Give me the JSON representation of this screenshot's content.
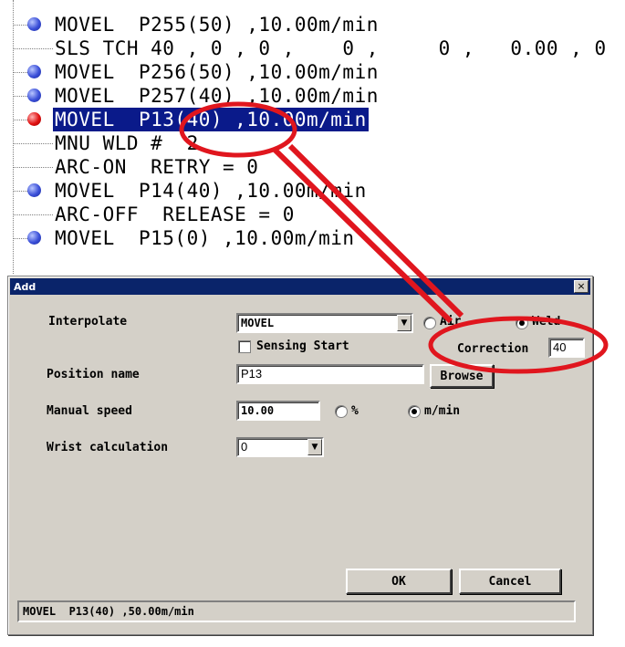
{
  "program": {
    "lines": [
      {
        "text": "MOVEL  P255(50) ,10.00m/min",
        "bullet": "blue"
      },
      {
        "text": "SLS TCH 40 , 0 , 0 ,    0 ,     0 ,   0.00 , 0",
        "bullet": "none"
      },
      {
        "text": "MOVEL  P256(50) ,10.00m/min",
        "bullet": "blue"
      },
      {
        "text": "MOVEL  P257(40) ,10.00m/min",
        "bullet": "blue"
      },
      {
        "text": "MOVEL  P13(40) ,10.00m/min",
        "bullet": "red",
        "selected": true
      },
      {
        "text": "MNU WLD #  2",
        "bullet": "none"
      },
      {
        "text": "ARC-ON  RETRY = 0",
        "bullet": "none"
      },
      {
        "text": "MOVEL  P14(40) ,10.00m/min",
        "bullet": "blue"
      },
      {
        "text": "ARC-OFF  RELEASE = 0",
        "bullet": "none"
      },
      {
        "text": "MOVEL  P15(0) ,10.00m/min",
        "bullet": "blue"
      }
    ]
  },
  "dialog": {
    "title": "Add",
    "close_label": "×",
    "interpolate_label": "Interpolate",
    "interpolate_value": "MOVEL",
    "air_label": "Air",
    "weld_label": "Weld",
    "sensing_start_label": "Sensing Start",
    "correction_label": "Correction",
    "correction_value": "40",
    "position_name_label": "Position name",
    "position_name_value": "P13",
    "browse_label": "Browse",
    "manual_speed_label": "Manual speed",
    "manual_speed_value": "10.00",
    "percent_label": "%",
    "mmin_label": "m/min",
    "wrist_calc_label": "Wrist calculation",
    "wrist_calc_value": "0",
    "ok_label": "OK",
    "cancel_label": "Cancel",
    "status_text": "MOVEL  P13(40) ,50.00m/min"
  },
  "colors": {
    "selection": "#0a1a8a",
    "annotation_red": "#e0161e",
    "blue_bullet": "#3a4fd8",
    "red_bullet": "#e01010",
    "dialog_bg": "#d4d0c8",
    "titlebar": "#0a246a"
  }
}
